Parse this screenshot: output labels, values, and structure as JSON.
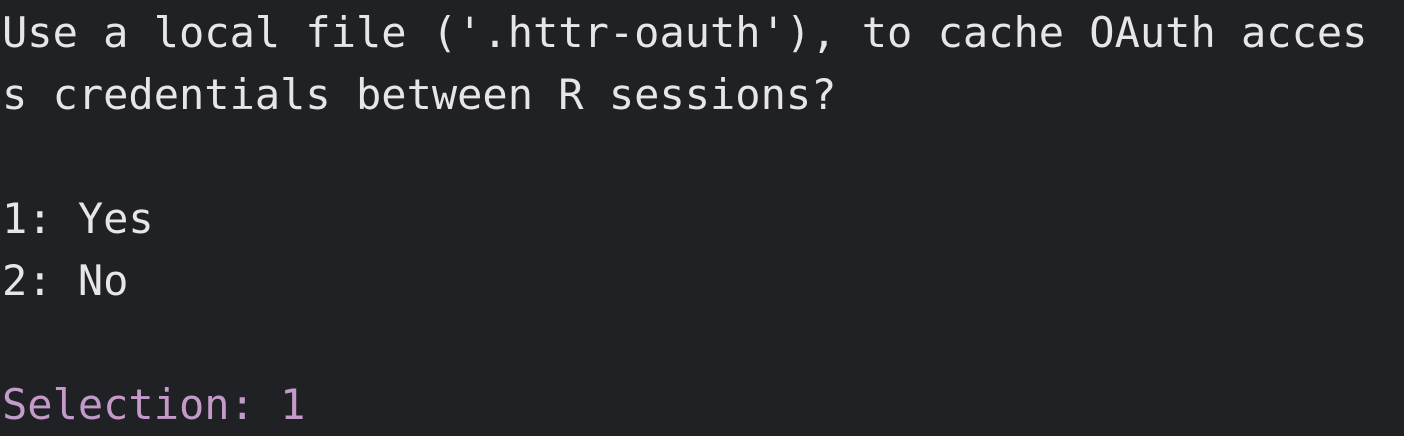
{
  "console": {
    "question_line_1": "Use a local file ('.httr-oauth'), to cache OAuth acces",
    "question_line_2": "s credentials between R sessions?",
    "options": [
      "1: Yes",
      "2: No"
    ],
    "selection_label": "Selection:",
    "selection_value": "1"
  },
  "colors": {
    "background": "#202124",
    "text": "#e6e6e6",
    "prompt": "#c39ac9"
  }
}
